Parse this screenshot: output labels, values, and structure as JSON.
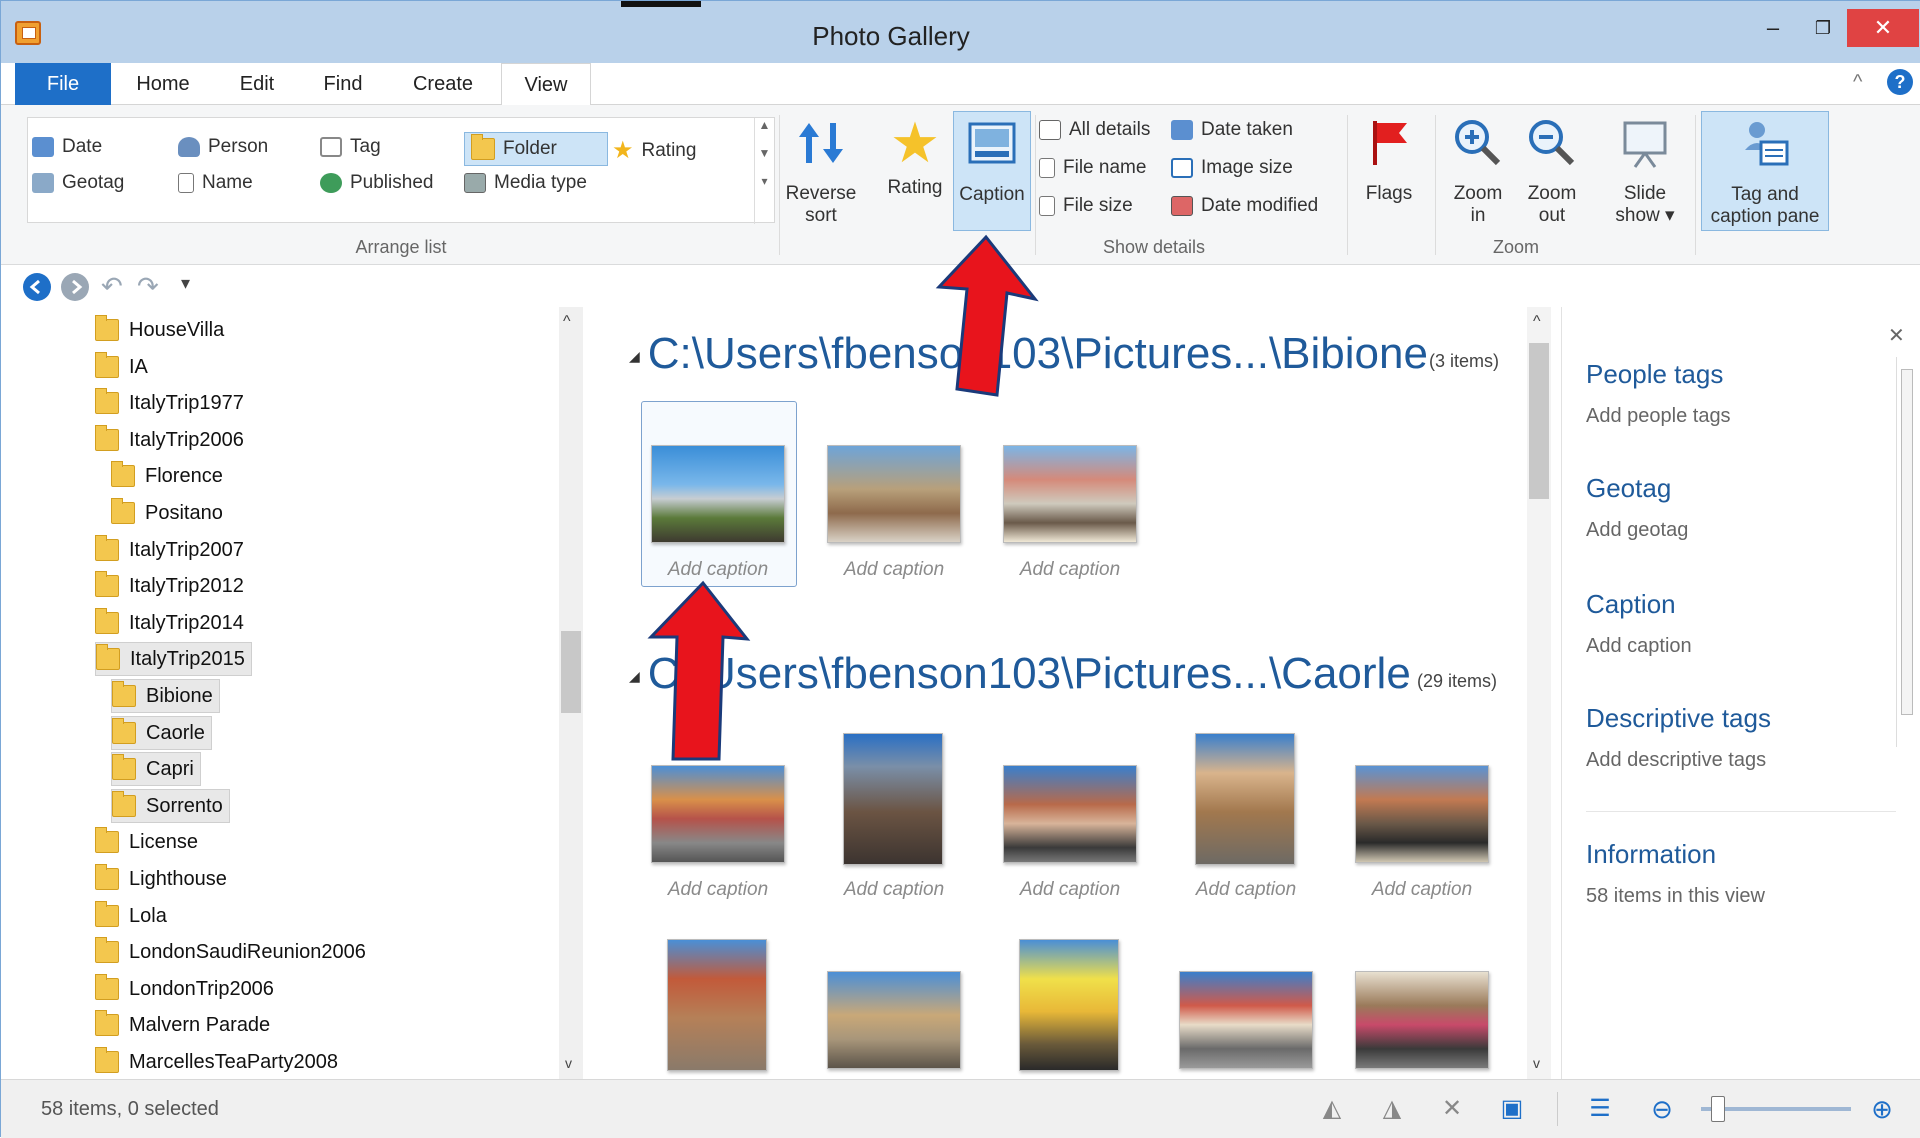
{
  "window": {
    "title": "Photo Gallery",
    "minimize_glyph": "–",
    "maximize_glyph": "❐",
    "close_glyph": "✕"
  },
  "tabs": [
    {
      "label": "File"
    },
    {
      "label": "Home"
    },
    {
      "label": "Edit"
    },
    {
      "label": "Find"
    },
    {
      "label": "Create"
    },
    {
      "label": "View"
    }
  ],
  "ribbon": {
    "arrange_list": {
      "label": "Arrange list",
      "items": [
        {
          "label": "Date"
        },
        {
          "label": "Person"
        },
        {
          "label": "Tag"
        },
        {
          "label": "Folder"
        },
        {
          "label": "Rating"
        },
        {
          "label": "Geotag"
        },
        {
          "label": "Name"
        },
        {
          "label": "Published"
        },
        {
          "label": "Media type"
        }
      ],
      "selected": "Folder"
    },
    "reverse_sort": {
      "line1": "Reverse",
      "line2": "sort"
    },
    "rating": "Rating",
    "caption": "Caption",
    "show_details": {
      "label": "Show details",
      "items": [
        {
          "label": "All details"
        },
        {
          "label": "Date taken"
        },
        {
          "label": "File name"
        },
        {
          "label": "Image size"
        },
        {
          "label": "File size"
        },
        {
          "label": "Date modified"
        }
      ]
    },
    "flags": "Flags",
    "zoom": {
      "label": "Zoom",
      "zoom_in": {
        "line1": "Zoom",
        "line2": "in"
      },
      "zoom_out": {
        "line1": "Zoom",
        "line2": "out"
      }
    },
    "slide_show": {
      "line1": "Slide",
      "line2": "show ▾"
    },
    "tag_caption_pane": {
      "line1": "Tag and",
      "line2": "caption pane"
    }
  },
  "nav": {
    "folders": [
      {
        "label": "HouseVilla"
      },
      {
        "label": "IA"
      },
      {
        "label": "ItalyTrip1977"
      },
      {
        "label": "ItalyTrip2006"
      },
      {
        "label": "Florence"
      },
      {
        "label": "Positano"
      },
      {
        "label": "ItalyTrip2007"
      },
      {
        "label": "ItalyTrip2012"
      },
      {
        "label": "ItalyTrip2014"
      },
      {
        "label": "ItalyTrip2015"
      },
      {
        "label": "Bibione"
      },
      {
        "label": "Caorle"
      },
      {
        "label": "Capri"
      },
      {
        "label": "Sorrento"
      },
      {
        "label": "License"
      },
      {
        "label": "Lighthouse"
      },
      {
        "label": "Lola"
      },
      {
        "label": "LondonSaudiReunion2006"
      },
      {
        "label": "LondonTrip2006"
      },
      {
        "label": "Malvern Parade"
      },
      {
        "label": "MarcellesTeaParty2008"
      }
    ]
  },
  "groups": [
    {
      "title": "C:\\Users\\fbenson103\\Pictures...\\Bibione",
      "count": "(3 items)"
    },
    {
      "title": "C:\\Users\\fbenson103\\Pictures...\\Caorle",
      "count": "(29 items)"
    }
  ],
  "caption_placeholder": "Add caption",
  "right_pane": {
    "people_tags": {
      "heading": "People tags",
      "sub": "Add people tags"
    },
    "geotag": {
      "heading": "Geotag",
      "sub": "Add geotag"
    },
    "caption": {
      "heading": "Caption",
      "sub": "Add caption"
    },
    "descriptive_tags": {
      "heading": "Descriptive tags",
      "sub": "Add descriptive tags"
    },
    "information": {
      "heading": "Information",
      "sub": "58 items in this view"
    },
    "close_glyph": "✕"
  },
  "status": {
    "text": "58 items, 0 selected"
  },
  "colors": {
    "accent": "#1e6fc8",
    "heading_blue": "#1f5a9a",
    "arrow_red": "#e8141c"
  }
}
